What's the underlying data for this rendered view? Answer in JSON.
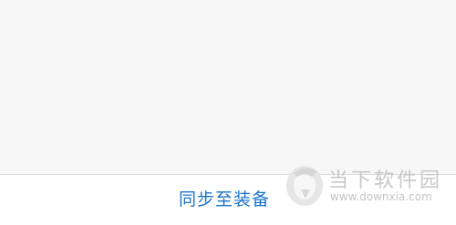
{
  "bottom_bar": {
    "sync_label": "同步至装备"
  },
  "watermark": {
    "title": "当下软件园",
    "url": "www.downxia.com"
  },
  "colors": {
    "accent": "#1a73c9",
    "background": "#f7f7f7",
    "bar_background": "#ffffff",
    "watermark": "#c8c8c8"
  },
  "icons": [
    "downxia-logo-icon"
  ]
}
